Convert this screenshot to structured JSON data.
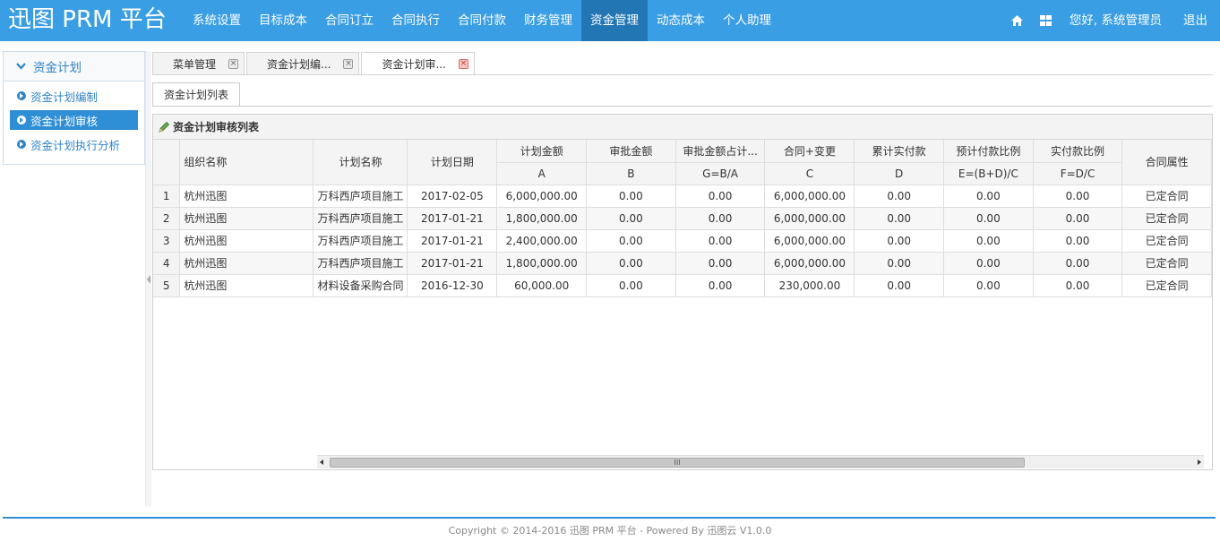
{
  "header": {
    "brand": "迅图 PRM 平台",
    "nav": [
      {
        "label": "系统设置"
      },
      {
        "label": "目标成本"
      },
      {
        "label": "合同订立"
      },
      {
        "label": "合同执行"
      },
      {
        "label": "合同付款"
      },
      {
        "label": "财务管理"
      },
      {
        "label": "资金管理",
        "active": true
      },
      {
        "label": "动态成本"
      },
      {
        "label": "个人助理"
      }
    ],
    "icons": [
      "home-icon",
      "grid-icon"
    ],
    "greeting": "您好, 系统管理员",
    "logout": "退出"
  },
  "sidebar": {
    "title": "资金计划",
    "items": [
      {
        "label": "资金计划编制"
      },
      {
        "label": "资金计划审核",
        "active": true
      },
      {
        "label": "资金计划执行分析"
      }
    ]
  },
  "tabs": [
    {
      "label": "菜单管理"
    },
    {
      "label": "资金计划编..."
    },
    {
      "label": "资金计划审...",
      "active": true
    }
  ],
  "subtab": "资金计划列表",
  "grid": {
    "title": "资金计划审核列表",
    "headers": {
      "org": "组织名称",
      "plan_name": "计划名称",
      "plan_date": "计划日期",
      "plan_amount": "计划金额",
      "plan_amount_sub": "A",
      "approved": "审批金额",
      "approved_sub": "B",
      "approved_ratio": "审批金额占计...",
      "approved_ratio_sub": "G=B/A",
      "contract": "合同+变更",
      "contract_sub": "C",
      "paid": "累计实付款",
      "paid_sub": "D",
      "expected_ratio": "预计付款比例",
      "expected_ratio_sub": "E=(B+D)/C",
      "actual_ratio": "实付款比例",
      "actual_ratio_sub": "F=D/C",
      "property": "合同属性"
    },
    "rows": [
      {
        "n": "1",
        "org": "杭州迅图",
        "plan_name": "万科西庐项目施工",
        "plan_date": "2017-02-05",
        "plan_amount": "6,000,000.00",
        "approved": "0.00",
        "approved_ratio": "0.00",
        "contract": "6,000,000.00",
        "paid": "0.00",
        "expected_ratio": "0.00",
        "actual_ratio": "0.00",
        "property": "已定合同"
      },
      {
        "n": "2",
        "org": "杭州迅图",
        "plan_name": "万科西庐项目施工",
        "plan_date": "2017-01-21",
        "plan_amount": "1,800,000.00",
        "approved": "0.00",
        "approved_ratio": "0.00",
        "contract": "6,000,000.00",
        "paid": "0.00",
        "expected_ratio": "0.00",
        "actual_ratio": "0.00",
        "property": "已定合同"
      },
      {
        "n": "3",
        "org": "杭州迅图",
        "plan_name": "万科西庐项目施工",
        "plan_date": "2017-01-21",
        "plan_amount": "2,400,000.00",
        "approved": "0.00",
        "approved_ratio": "0.00",
        "contract": "6,000,000.00",
        "paid": "0.00",
        "expected_ratio": "0.00",
        "actual_ratio": "0.00",
        "property": "已定合同"
      },
      {
        "n": "4",
        "org": "杭州迅图",
        "plan_name": "万科西庐项目施工",
        "plan_date": "2017-01-21",
        "plan_amount": "1,800,000.00",
        "approved": "0.00",
        "approved_ratio": "0.00",
        "contract": "6,000,000.00",
        "paid": "0.00",
        "expected_ratio": "0.00",
        "actual_ratio": "0.00",
        "property": "已定合同"
      },
      {
        "n": "5",
        "org": "杭州迅图",
        "plan_name": "材料设备采购合同",
        "plan_date": "2016-12-30",
        "plan_amount": "60,000.00",
        "approved": "0.00",
        "approved_ratio": "0.00",
        "contract": "230,000.00",
        "paid": "0.00",
        "expected_ratio": "0.00",
        "actual_ratio": "0.00",
        "property": "已定合同"
      }
    ]
  },
  "scrollbar": {
    "thumb_label": "III"
  },
  "footer": "Copyright © 2014-2016 迅图 PRM 平台 - Powered By 迅图云 V1.0.0"
}
